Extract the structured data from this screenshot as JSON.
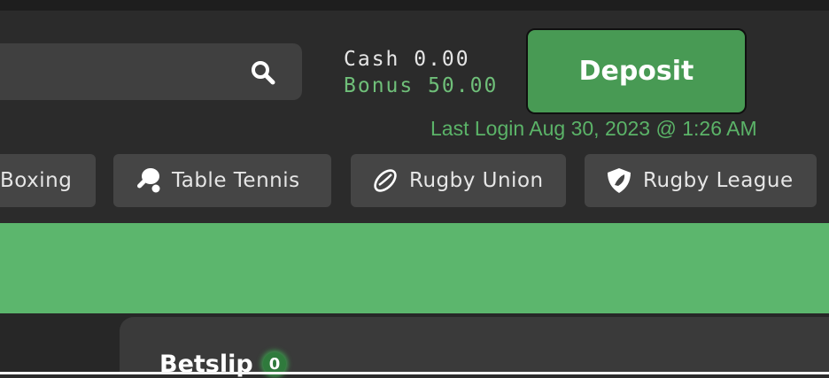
{
  "search": {
    "placeholder": "",
    "value": ""
  },
  "balance": {
    "cash_label": "Cash 0.00",
    "bonus_label": "Bonus 50.00"
  },
  "deposit_label": "Deposit",
  "last_login": "Last Login Aug 30, 2023 @ 1:26 AM",
  "sports": [
    {
      "label": "Boxing",
      "icon": "boxing-icon"
    },
    {
      "label": "Table Tennis",
      "icon": "table-tennis-icon"
    },
    {
      "label": "Rugby Union",
      "icon": "rugby-ball-icon"
    },
    {
      "label": "Rugby League",
      "icon": "shield-icon"
    }
  ],
  "betslip": {
    "title": "Betslip",
    "count": "0"
  },
  "colors": {
    "accent": "#5cb66d",
    "deposit_bg": "#489a54",
    "bonus_text": "#6fbf79",
    "background": "#2b2b2b",
    "tab_bg": "#454545"
  }
}
